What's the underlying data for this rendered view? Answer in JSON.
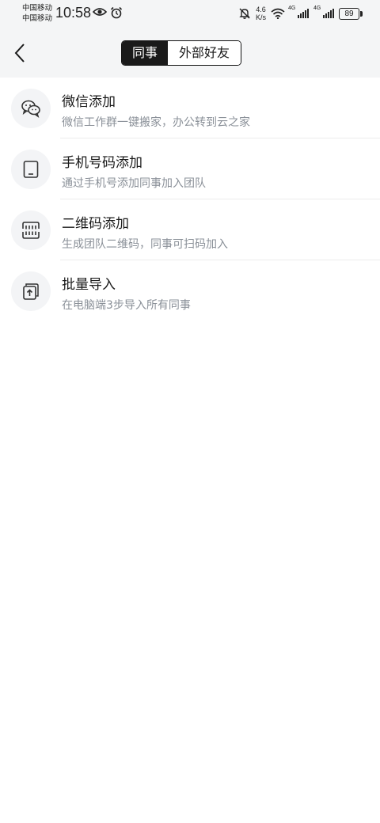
{
  "status_bar": {
    "carrier_1": "中国移动",
    "carrier_2": "中国移动",
    "time": "10:58",
    "speed_value": "4.6",
    "speed_unit": "K/s",
    "sig1_label": "4G",
    "sig2_label": "4G",
    "battery": "89"
  },
  "nav": {
    "tabs": [
      {
        "label": "同事",
        "active": true
      },
      {
        "label": "外部好友",
        "active": false
      }
    ]
  },
  "items": [
    {
      "title": "微信添加",
      "subtitle": "微信工作群一键搬家，办公转到云之家",
      "icon": "wechat-icon"
    },
    {
      "title": "手机号码添加",
      "subtitle": "通过手机号添加同事加入团队",
      "icon": "tablet-icon"
    },
    {
      "title": "二维码添加",
      "subtitle": "生成团队二维码，同事可扫码加入",
      "icon": "qrcode-icon"
    },
    {
      "title": "批量导入",
      "subtitle": "在电脑端3步导入所有同事",
      "icon": "import-icon"
    }
  ]
}
